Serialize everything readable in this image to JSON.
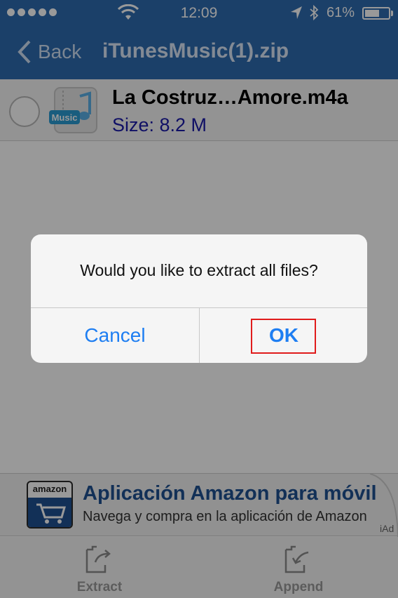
{
  "status_bar": {
    "time": "12:09",
    "battery_percent": "61%",
    "battery_level": 0.61
  },
  "nav": {
    "back_label": "Back",
    "title": "iTunesMusic(1).zip"
  },
  "file": {
    "icon_badge": "Music",
    "name": "La Costruz…Amore.m4a",
    "size": "Size: 8.2 M"
  },
  "dialog": {
    "message": "Would you like to extract all files?",
    "cancel_label": "Cancel",
    "ok_label": "OK"
  },
  "ad": {
    "logo_text": "amazon",
    "title": "Aplicación Amazon para móvil",
    "subtitle": "Navega y compra en la aplicación de Amazon",
    "badge": "iAd"
  },
  "toolbar": {
    "extract_label": "Extract",
    "append_label": "Append"
  },
  "colors": {
    "nav_bar": "#2e6bb0",
    "link_blue": "#1e7ef2",
    "highlight_red": "#e01b1b"
  },
  "icons": [
    "signal-dots-icon",
    "wifi-icon",
    "location-icon",
    "bluetooth-icon",
    "battery-icon",
    "back-chevron-icon",
    "music-file-icon",
    "amazon-logo-icon",
    "extract-icon",
    "append-icon"
  ]
}
